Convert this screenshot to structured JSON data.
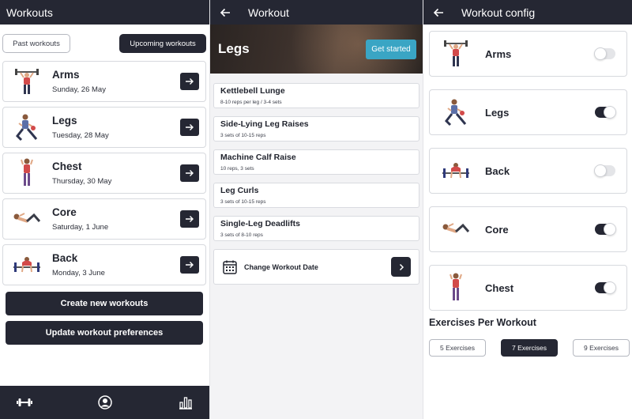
{
  "workouts_screen": {
    "title": "Workouts",
    "tabs": {
      "past": "Past workouts",
      "upcoming": "Upcoming workouts"
    },
    "items": [
      {
        "name": "Arms",
        "date": "Sunday, 26 May",
        "icon": "arms-figure-icon"
      },
      {
        "name": "Legs",
        "date": "Tuesday, 28 May",
        "icon": "legs-figure-icon"
      },
      {
        "name": "Chest",
        "date": "Thursday, 30 May",
        "icon": "chest-figure-icon"
      },
      {
        "name": "Core",
        "date": "Saturday, 1 June",
        "icon": "core-figure-icon"
      },
      {
        "name": "Back",
        "date": "Monday, 3 June",
        "icon": "back-figure-icon"
      }
    ],
    "create_button": "Create new workouts",
    "update_button": "Update workout preferences",
    "bottom_nav": [
      "dumbbell-icon",
      "profile-icon",
      "stats-icon"
    ]
  },
  "workout_screen": {
    "title": "Workout",
    "hero_title": "Legs",
    "get_started": "Get started",
    "exercises": [
      {
        "name": "Kettlebell Lunge",
        "desc": "8-10 reps per leg / 3-4 sets"
      },
      {
        "name": "Side-Lying Leg Raises",
        "desc": "3 sets of 10-15 reps"
      },
      {
        "name": "Machine Calf Raise",
        "desc": "10 reps, 3 sets"
      },
      {
        "name": "Leg Curls",
        "desc": "3 sets of 10-15 reps"
      },
      {
        "name": "Single-Leg Deadlifts",
        "desc": "3 sets of 8-10 reps"
      }
    ],
    "change_date": "Change Workout Date"
  },
  "config_screen": {
    "title": "Workout config",
    "items": [
      {
        "name": "Arms",
        "enabled": false
      },
      {
        "name": "Legs",
        "enabled": true
      },
      {
        "name": "Back",
        "enabled": false
      },
      {
        "name": "Core",
        "enabled": true
      },
      {
        "name": "Chest",
        "enabled": true
      }
    ],
    "exercises_heading": "Exercises Per Workout",
    "exercise_options": [
      "5 Exercises",
      "7 Exercises",
      "9 Exercises"
    ],
    "selected_option": "7 Exercises"
  },
  "colors": {
    "dark": "#252733",
    "accent": "#3aa5c4"
  }
}
